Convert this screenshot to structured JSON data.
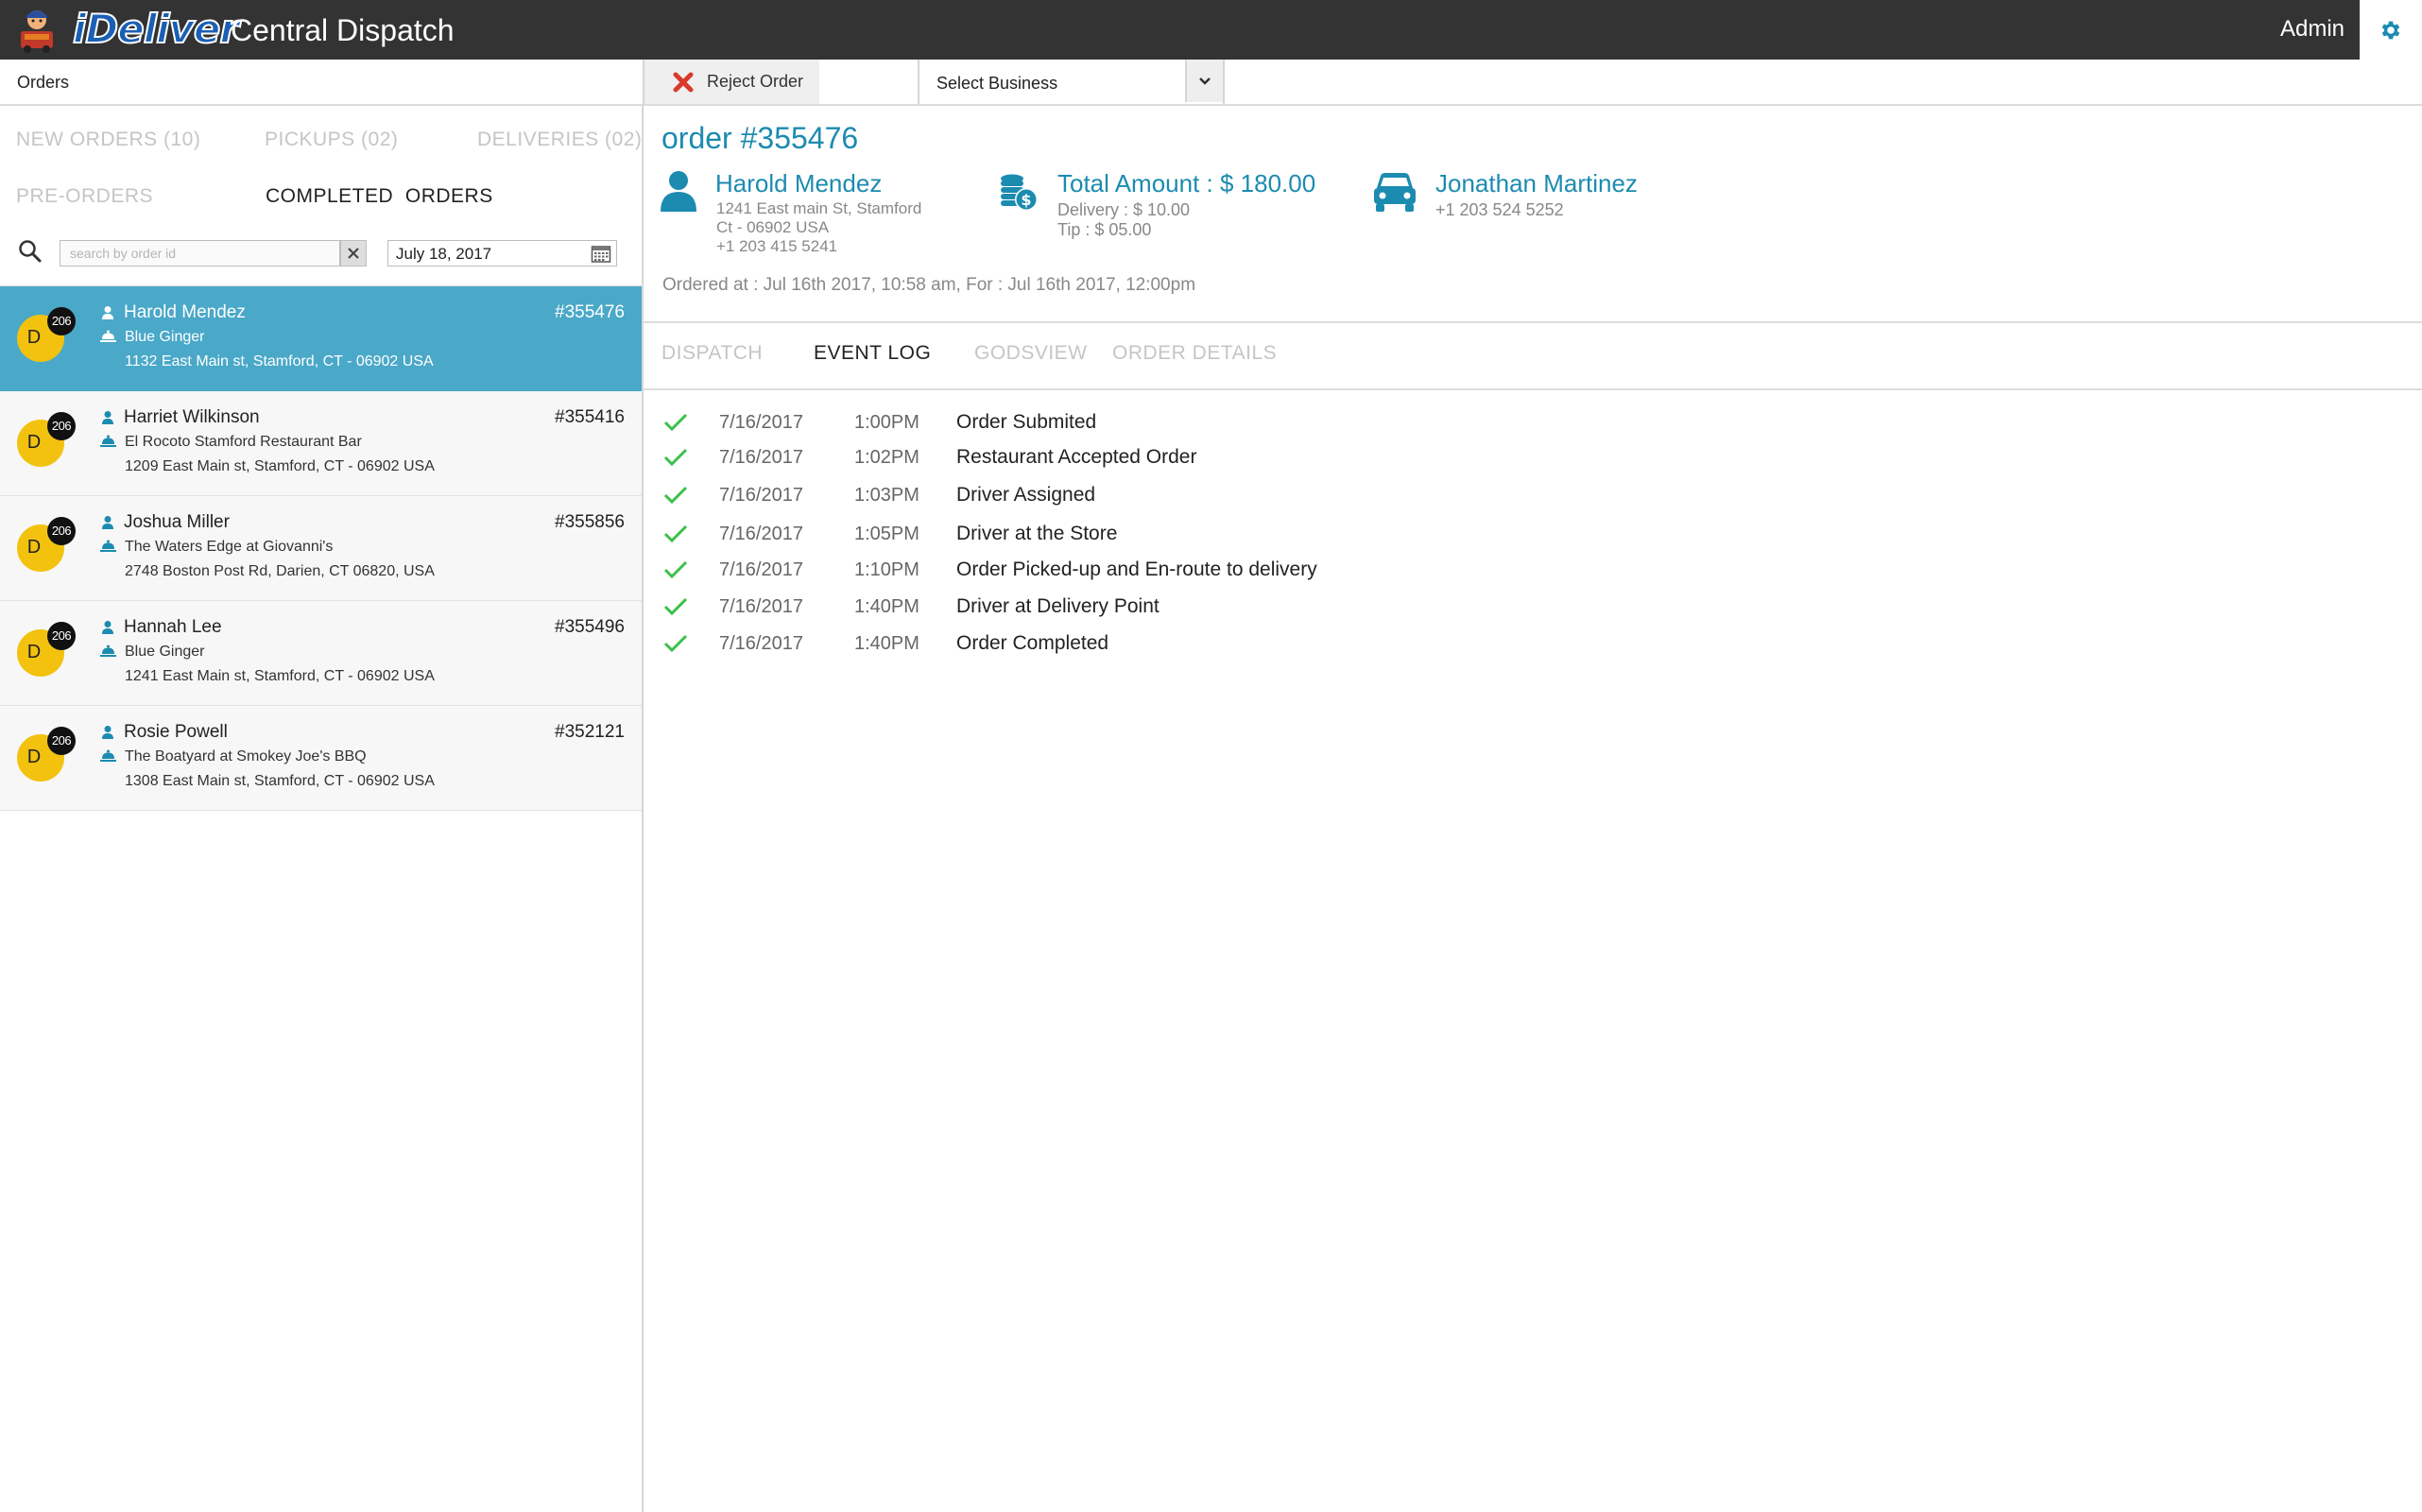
{
  "header": {
    "logo_text": "iDeliver",
    "app_title": "Central Dispatch",
    "user_label": "Admin"
  },
  "toolbar": {
    "orders_label": "Orders",
    "reject_label": "Reject Order",
    "business_select": "Select Business"
  },
  "sidebar": {
    "tabs": [
      {
        "label": "NEW ORDERS (10)"
      },
      {
        "label": "PICKUPS (02)"
      },
      {
        "label": "DELIVERIES (02)"
      },
      {
        "label": "PRE-ORDERS"
      },
      {
        "label": "COMPLETED  ORDERS"
      }
    ],
    "active_tab": "COMPLETED  ORDERS",
    "search_placeholder": "search by order id",
    "date_value": "July 18, 2017",
    "orders": [
      {
        "avatar": "D",
        "badge": "206",
        "customer": "Harold Mendez",
        "business": "Blue Ginger",
        "address": "1132 East Main st, Stamford, CT - 06902 USA",
        "order_id": "#355476",
        "selected": true
      },
      {
        "avatar": "D",
        "badge": "206",
        "customer": "Harriet Wilkinson",
        "business": "El Rocoto Stamford Restaurant Bar",
        "address": "1209 East Main st, Stamford, CT - 06902 USA",
        "order_id": "#355416",
        "selected": false
      },
      {
        "avatar": "D",
        "badge": "206",
        "customer": "Joshua Miller",
        "business": "The Waters Edge at Giovanni's",
        "address": "2748 Boston Post Rd, Darien, CT 06820, USA",
        "order_id": "#355856",
        "selected": false
      },
      {
        "avatar": "D",
        "badge": "206",
        "customer": "Hannah Lee",
        "business": "Blue Ginger",
        "address": "1241 East Main st, Stamford, CT - 06902 USA",
        "order_id": "#355496",
        "selected": false
      },
      {
        "avatar": "D",
        "badge": "206",
        "customer": "Rosie Powell",
        "business": "The Boatyard at Smokey Joe's BBQ",
        "address": "1308 East Main st, Stamford, CT - 06902 USA",
        "order_id": "#352121",
        "selected": false
      }
    ]
  },
  "detail": {
    "order_title": "order #355476",
    "customer": {
      "name": "Harold Mendez",
      "address_line1": "1241 East main St, Stamford",
      "address_line2": "Ct - 06902 USA",
      "phone": "+1 203 415 5241"
    },
    "payment": {
      "total": "Total Amount : $ 180.00",
      "delivery": "Delivery : $ 10.00",
      "tip": "Tip : $ 05.00"
    },
    "driver": {
      "name": "Jonathan Martinez",
      "phone": "+1 203 524 5252"
    },
    "ordered_at": "Ordered at : Jul 16th 2017, 10:58 am, For : Jul 16th 2017, 12:00pm",
    "tabs": [
      {
        "label": "DISPATCH"
      },
      {
        "label": "EVENT LOG"
      },
      {
        "label": "GODSVIEW"
      },
      {
        "label": "ORDER DETAILS"
      }
    ],
    "active_tab": "EVENT LOG",
    "events": [
      {
        "date": "7/16/2017",
        "time": "1:00PM",
        "event": "Order Submited"
      },
      {
        "date": "7/16/2017",
        "time": "1:02PM",
        "event": "Restaurant Accepted Order"
      },
      {
        "date": "7/16/2017",
        "time": "1:03PM",
        "event": "Driver Assigned"
      },
      {
        "date": "7/16/2017",
        "time": "1:05PM",
        "event": "Driver at the Store"
      },
      {
        "date": "7/16/2017",
        "time": "1:10PM",
        "event": "Order Picked-up and En-route to delivery"
      },
      {
        "date": "7/16/2017",
        "time": "1:40PM",
        "event": "Driver at Delivery Point"
      },
      {
        "date": "7/16/2017",
        "time": "1:40PM",
        "event": "Order Completed"
      }
    ]
  },
  "colors": {
    "topbar": "#333333",
    "accent": "#1c8bb0",
    "selected_row": "#4aa8c8",
    "avatar": "#f2c20f",
    "check": "#3cbf4a",
    "reject": "#d93a2b"
  },
  "icons": [
    "logo-mascot-icon",
    "gear-icon",
    "close-icon",
    "chevron-down-icon",
    "search-icon",
    "calendar-icon",
    "person-icon",
    "cloche-icon",
    "coins-icon",
    "car-icon",
    "check-icon"
  ]
}
